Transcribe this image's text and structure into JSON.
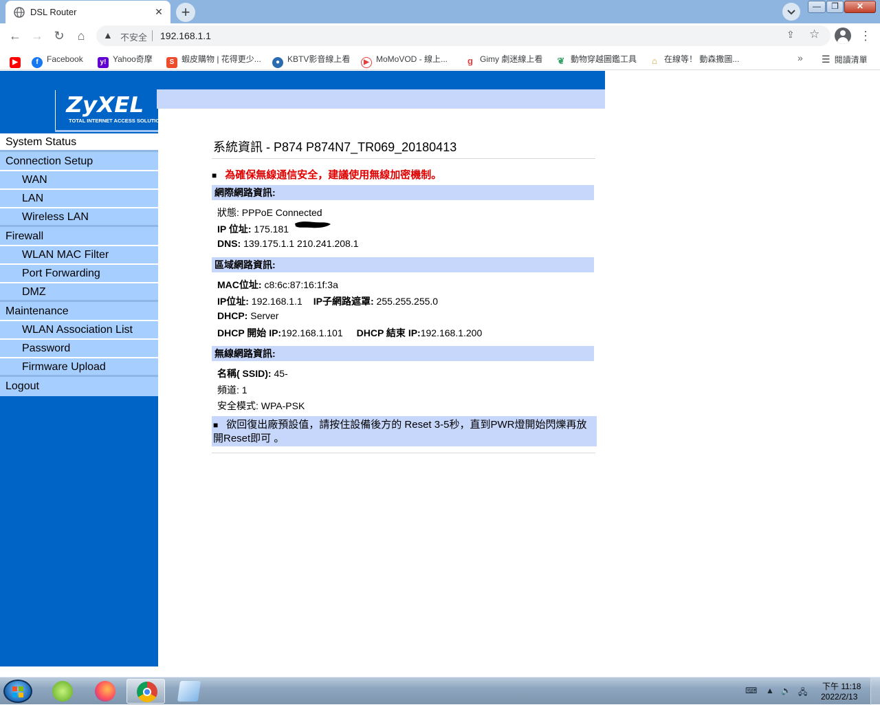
{
  "browser": {
    "tab_title": "DSL Router",
    "tab_close": "✕",
    "new_tab": "+",
    "insecure_label": "不安全",
    "url": "192.168.1.1",
    "bookmarks": [
      {
        "label": "",
        "icon": "youtube-icon",
        "color": "#ff0000"
      },
      {
        "label": "Facebook",
        "icon": "facebook-icon",
        "color": "#1877f2"
      },
      {
        "label": "Yahoo奇摩",
        "icon": "yahoo-icon",
        "color": "#6001d2"
      },
      {
        "label": "蝦皮購物 | 花得更少...",
        "icon": "shopee-icon",
        "color": "#ee4d2d"
      },
      {
        "label": "KBTV影音線上看",
        "icon": "kbtv-icon",
        "color": "#2b6cb0"
      },
      {
        "label": "MoMoVOD - 線上...",
        "icon": "momovod-icon",
        "color": "#e53e3e"
      },
      {
        "label": "Gimy 劇迷線上看",
        "icon": "gimy-icon",
        "color": "#e53e3e"
      },
      {
        "label": "動物穿越圖鑑工具",
        "icon": "animal-crossing-icon",
        "color": "#38a169"
      },
      {
        "label": "在線等！ 動森撒圖...",
        "icon": "acnh-map-icon",
        "color": "#d69e2e"
      }
    ],
    "more_bookmarks": "»",
    "reading_list": "閱讀清單"
  },
  "router": {
    "brand": "ZyXEL",
    "tagline": "TOTAL INTERNET ACCESS SOLUTION",
    "nav": [
      {
        "label": "System Status",
        "type": "cat",
        "selected": true
      },
      {
        "label": "Connection Setup",
        "type": "cat"
      },
      {
        "label": "WAN",
        "type": "sub"
      },
      {
        "label": "LAN",
        "type": "sub"
      },
      {
        "label": "Wireless LAN",
        "type": "sub"
      },
      {
        "label": "Firewall",
        "type": "cat"
      },
      {
        "label": "WLAN MAC Filter",
        "type": "sub"
      },
      {
        "label": "Port Forwarding",
        "type": "sub"
      },
      {
        "label": "DMZ",
        "type": "sub"
      },
      {
        "label": "Maintenance",
        "type": "cat"
      },
      {
        "label": "WLAN Association List",
        "type": "sub"
      },
      {
        "label": "Password",
        "type": "sub"
      },
      {
        "label": "Firmware Upload",
        "type": "sub"
      },
      {
        "label": "Logout",
        "type": "cat"
      }
    ],
    "page_title": "系統資訊 - P874   P874N7_TR069_20180413",
    "security_warning": "為確保無線通信安全，建議使用無線加密機制。",
    "internet": {
      "heading": "網際網路資訊:",
      "status_label": "狀態:",
      "status_value": "PPPoE   Connected",
      "ip_label": "IP 位址:",
      "ip_value": "175.181",
      "dns_label": "DNS:",
      "dns_value": "139.175.1.1   210.241.208.1"
    },
    "lan": {
      "heading": "區域網路資訊:",
      "mac_label": "MAC位址:",
      "mac_value": "c8:6c:87:16:1f:3a",
      "ip_label": "IP位址:",
      "ip_value": "192.168.1.1",
      "mask_label": "IP子網路遮罩:",
      "mask_value": "255.255.255.0",
      "dhcp_label": "DHCP:",
      "dhcp_value": "Server",
      "dhcp_start_label": "DHCP 開始 IP:",
      "dhcp_start_value": "192.168.1.101",
      "dhcp_end_label": "DHCP 結束 IP:",
      "dhcp_end_value": "192.168.1.200"
    },
    "wireless": {
      "heading": "無線網路資訊:",
      "ssid_label": "名稱( SSID):",
      "ssid_value": "45-",
      "channel_label": "頻道:",
      "channel_value": "1",
      "security_label": "安全模式:",
      "security_value": "WPA-PSK"
    },
    "reset_note": "欲回復出廠預設值，請按住設備後方的 Reset 3-5秒，直到PWR燈開始閃爍再放開Reset即可 。"
  },
  "taskbar": {
    "clock_time": "下午 11:18",
    "clock_date": "2022/2/13"
  }
}
